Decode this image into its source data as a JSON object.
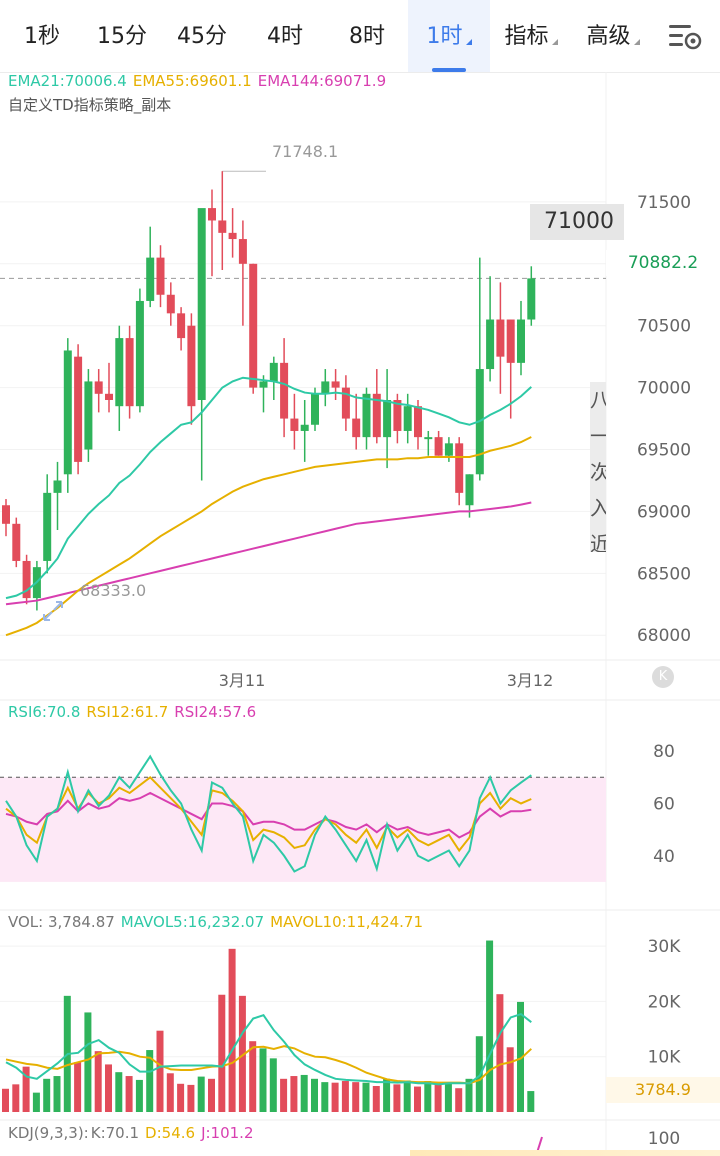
{
  "tabs": [
    {
      "label": "1秒",
      "active": false
    },
    {
      "label": "15分",
      "active": false
    },
    {
      "label": "45分",
      "active": false
    },
    {
      "label": "4时",
      "active": false
    },
    {
      "label": "8时",
      "active": false
    },
    {
      "label": "1时",
      "active": true
    },
    {
      "label": "指标",
      "active": false,
      "dropdown": true
    },
    {
      "label": "高级",
      "active": false,
      "dropdown": true
    }
  ],
  "settings_icon": "chart-settings-icon",
  "main_legend": {
    "ema21": "EMA21:70006.4",
    "ema55": "EMA55:69601.1",
    "ema144": "EMA144:69071.9",
    "strategy": "自定义TD指标策略_副本"
  },
  "price_axis": [
    "71500",
    "71000",
    "70500",
    "70000",
    "69500",
    "69000",
    "68500",
    "68000"
  ],
  "current_price": "70882.2",
  "price_flag": "71000",
  "side_panel_text": "八一次入近",
  "high_label": "71748.1",
  "low_label": "68333.0",
  "date_labels": [
    "3月11",
    "3月12"
  ],
  "rsi_legend": {
    "rsi6": "RSI6:70.8",
    "rsi12": "RSI12:61.7",
    "rsi24": "RSI24:57.6"
  },
  "rsi_axis": [
    "80",
    "60",
    "40"
  ],
  "vol_legend": {
    "vol": "VOL: 3,784.87",
    "mavol5": "MAVOL5:16,232.07",
    "mavol10": "MAVOL10:11,424.71"
  },
  "vol_axis": [
    "30K",
    "20K",
    "10K"
  ],
  "current_volume": "3784.9",
  "kdj_legend": {
    "name": "KDJ(9,3,3):",
    "k": "K:70.1",
    "d": "D:54.6",
    "j": "J:101.2"
  },
  "kdj_axis": [
    "100"
  ],
  "colors": {
    "up": "#2fb35b",
    "down": "#e24c5a",
    "ema21": "#2ec9a6",
    "ema55": "#e6b000",
    "ema144": "#d83fb0",
    "rsi_band": "#fde8f6",
    "accent": "#3d7bea"
  },
  "chart_data": {
    "type": "candlestick",
    "candles": [
      {
        "o": 69050,
        "h": 69100,
        "l": 68800,
        "c": 68900
      },
      {
        "o": 68900,
        "h": 68950,
        "l": 68550,
        "c": 68600
      },
      {
        "o": 68600,
        "h": 68650,
        "l": 68250,
        "c": 68300
      },
      {
        "o": 68300,
        "h": 68600,
        "l": 68200,
        "c": 68550
      },
      {
        "o": 68600,
        "h": 69300,
        "l": 68500,
        "c": 69150
      },
      {
        "o": 69150,
        "h": 69400,
        "l": 68850,
        "c": 69250
      },
      {
        "o": 69300,
        "h": 70400,
        "l": 69150,
        "c": 70300
      },
      {
        "o": 70250,
        "h": 70350,
        "l": 69300,
        "c": 69400
      },
      {
        "o": 69500,
        "h": 70150,
        "l": 69400,
        "c": 70050
      },
      {
        "o": 70050,
        "h": 70150,
        "l": 69800,
        "c": 69950
      },
      {
        "o": 69950,
        "h": 70200,
        "l": 69800,
        "c": 69900
      },
      {
        "o": 69850,
        "h": 70500,
        "l": 69650,
        "c": 70400
      },
      {
        "o": 70400,
        "h": 70500,
        "l": 69750,
        "c": 69850
      },
      {
        "o": 69850,
        "h": 70800,
        "l": 69800,
        "c": 70700
      },
      {
        "o": 70700,
        "h": 71300,
        "l": 70650,
        "c": 71050
      },
      {
        "o": 71050,
        "h": 71150,
        "l": 70650,
        "c": 70750
      },
      {
        "o": 70750,
        "h": 70850,
        "l": 70500,
        "c": 70600
      },
      {
        "o": 70600,
        "h": 70650,
        "l": 70300,
        "c": 70400
      },
      {
        "o": 70500,
        "h": 70600,
        "l": 69700,
        "c": 69850
      },
      {
        "o": 69900,
        "h": 71000,
        "l": 69250,
        "c": 71450
      },
      {
        "o": 71450,
        "h": 71600,
        "l": 70900,
        "c": 71350
      },
      {
        "o": 71350,
        "h": 71748.1,
        "l": 70950,
        "c": 71250
      },
      {
        "o": 71250,
        "h": 71450,
        "l": 71050,
        "c": 71200
      },
      {
        "o": 71200,
        "h": 71350,
        "l": 70500,
        "c": 71000
      },
      {
        "o": 71000,
        "h": 71000,
        "l": 69950,
        "c": 70000
      },
      {
        "o": 70000,
        "h": 70100,
        "l": 69800,
        "c": 70050
      },
      {
        "o": 70050,
        "h": 70250,
        "l": 69900,
        "c": 70200
      },
      {
        "o": 70200,
        "h": 70400,
        "l": 69600,
        "c": 69750
      },
      {
        "o": 69750,
        "h": 69950,
        "l": 69500,
        "c": 69650
      },
      {
        "o": 69650,
        "h": 69900,
        "l": 69400,
        "c": 69700
      },
      {
        "o": 69700,
        "h": 70000,
        "l": 69650,
        "c": 69950
      },
      {
        "o": 69950,
        "h": 70150,
        "l": 69850,
        "c": 70050
      },
      {
        "o": 70050,
        "h": 70150,
        "l": 69900,
        "c": 70000
      },
      {
        "o": 70000,
        "h": 70100,
        "l": 69650,
        "c": 69750
      },
      {
        "o": 69750,
        "h": 69950,
        "l": 69500,
        "c": 69600
      },
      {
        "o": 69600,
        "h": 70000,
        "l": 69500,
        "c": 69950
      },
      {
        "o": 69950,
        "h": 70150,
        "l": 69550,
        "c": 69600
      },
      {
        "o": 69600,
        "h": 70150,
        "l": 69350,
        "c": 69900
      },
      {
        "o": 69900,
        "h": 69950,
        "l": 69550,
        "c": 69650
      },
      {
        "o": 69650,
        "h": 69950,
        "l": 69550,
        "c": 69850
      },
      {
        "o": 69850,
        "h": 69900,
        "l": 69500,
        "c": 69600
      },
      {
        "o": 69600,
        "h": 69650,
        "l": 69450,
        "c": 69600
      },
      {
        "o": 69600,
        "h": 69650,
        "l": 69450,
        "c": 69450
      },
      {
        "o": 69450,
        "h": 69600,
        "l": 69400,
        "c": 69550
      },
      {
        "o": 69550,
        "h": 69600,
        "l": 69050,
        "c": 69150
      },
      {
        "o": 69050,
        "h": 69300,
        "l": 68950,
        "c": 69300
      },
      {
        "o": 69300,
        "h": 71050,
        "l": 69250,
        "c": 70150
      },
      {
        "o": 70150,
        "h": 70900,
        "l": 70050,
        "c": 70550
      },
      {
        "o": 70550,
        "h": 70850,
        "l": 69950,
        "c": 70250
      },
      {
        "o": 70550,
        "h": 70550,
        "l": 69750,
        "c": 70200
      },
      {
        "o": 70200,
        "h": 70700,
        "l": 70100,
        "c": 70550
      },
      {
        "o": 70550,
        "h": 70980,
        "l": 70500,
        "c": 70882.2
      }
    ],
    "ema21": [
      68300,
      68320,
      68360,
      68430,
      68520,
      68620,
      68780,
      68880,
      68980,
      69060,
      69130,
      69230,
      69290,
      69380,
      69480,
      69560,
      69630,
      69700,
      69720,
      69800,
      69900,
      70000,
      70050,
      70080,
      70070,
      70060,
      70050,
      70030,
      69990,
      69960,
      69950,
      69950,
      69960,
      69950,
      69920,
      69910,
      69900,
      69890,
      69870,
      69860,
      69840,
      69820,
      69790,
      69760,
      69720,
      69700,
      69730,
      69780,
      69820,
      69870,
      69930,
      70006.4
    ],
    "ema55": [
      68000,
      68030,
      68060,
      68100,
      68160,
      68220,
      68290,
      68360,
      68420,
      68470,
      68520,
      68570,
      68620,
      68680,
      68740,
      68800,
      68850,
      68900,
      68950,
      69000,
      69060,
      69110,
      69160,
      69200,
      69230,
      69260,
      69280,
      69300,
      69320,
      69340,
      69360,
      69370,
      69380,
      69390,
      69400,
      69410,
      69420,
      69420,
      69420,
      69430,
      69430,
      69440,
      69440,
      69440,
      69440,
      69440,
      69460,
      69490,
      69510,
      69530,
      69560,
      69601.1
    ],
    "ema144": [
      68250,
      68260,
      68270,
      68280,
      68300,
      68320,
      68340,
      68360,
      68380,
      68400,
      68420,
      68440,
      68460,
      68480,
      68500,
      68520,
      68540,
      68560,
      68580,
      68600,
      68620,
      68640,
      68660,
      68680,
      68700,
      68720,
      68740,
      68760,
      68780,
      68800,
      68820,
      68840,
      68860,
      68880,
      68900,
      68910,
      68920,
      68930,
      68940,
      68950,
      68960,
      68970,
      68980,
      68990,
      69000,
      69000,
      69010,
      69020,
      69030,
      69040,
      69055,
      69071.9
    ],
    "rsi6": [
      61,
      55,
      44,
      38,
      55,
      58,
      72,
      57,
      65,
      59,
      63,
      70,
      66,
      72,
      78,
      71,
      65,
      60,
      50,
      42,
      68,
      66,
      60,
      55,
      38,
      48,
      45,
      40,
      34,
      36,
      48,
      55,
      50,
      44,
      38,
      46,
      35,
      52,
      42,
      48,
      40,
      38,
      40,
      42,
      36,
      42,
      62,
      70,
      60,
      65,
      68,
      70.8
    ],
    "rsi12": [
      58,
      55,
      48,
      45,
      55,
      58,
      66,
      58,
      64,
      60,
      62,
      66,
      64,
      67,
      70,
      66,
      62,
      58,
      53,
      48,
      65,
      64,
      61,
      57,
      46,
      50,
      49,
      47,
      43,
      44,
      50,
      54,
      52,
      48,
      45,
      50,
      43,
      51,
      47,
      50,
      46,
      44,
      46,
      48,
      42,
      47,
      60,
      64,
      58,
      62,
      60,
      61.7
    ],
    "rsi24": [
      56,
      55,
      53,
      52,
      56,
      57,
      61,
      57,
      60,
      58,
      59,
      62,
      61,
      62,
      64,
      62,
      60,
      58,
      56,
      54,
      60,
      60,
      59,
      57,
      52,
      53,
      53,
      52,
      50,
      50,
      52,
      54,
      53,
      51,
      50,
      52,
      49,
      52,
      50,
      51,
      49,
      48,
      49,
      50,
      47,
      49,
      55,
      58,
      55,
      57,
      57,
      57.6
    ],
    "volume": [
      4200,
      5000,
      8200,
      3500,
      6000,
      6500,
      21000,
      9000,
      18000,
      11000,
      8600,
      7200,
      6500,
      5800,
      11200,
      14700,
      7000,
      5100,
      4900,
      6400,
      6000,
      21200,
      29500,
      21000,
      12800,
      11500,
      9700,
      6000,
      6500,
      6700,
      6000,
      5400,
      5300,
      5600,
      5400,
      5300,
      4700,
      6000,
      5000,
      5700,
      4600,
      5600,
      5100,
      5200,
      4300,
      6000,
      13700,
      31000,
      21300,
      11700,
      19900,
      3784.87
    ],
    "mavol5": [
      9000,
      8000,
      6400,
      6000,
      7400,
      8800,
      10500,
      10700,
      12300,
      13000,
      11600,
      10700,
      8600,
      7300,
      7300,
      8200,
      8300,
      8400,
      8400,
      8400,
      8400,
      8200,
      11300,
      14400,
      16900,
      17500,
      14800,
      12700,
      10300,
      8600,
      7600,
      6700,
      6000,
      5800,
      5700,
      5600,
      5400,
      5400,
      5300,
      5400,
      5200,
      5200,
      5000,
      5200,
      5200,
      5200,
      6600,
      10500,
      14300,
      17100,
      17700,
      16232.07
    ],
    "mavol10": [
      9500,
      9100,
      8700,
      8500,
      8000,
      7800,
      8500,
      9000,
      9500,
      10600,
      10700,
      10900,
      10600,
      10000,
      9800,
      8400,
      7700,
      7600,
      7600,
      7900,
      8200,
      8300,
      8900,
      10300,
      11700,
      11800,
      11400,
      11900,
      11500,
      10600,
      10000,
      9900,
      9400,
      8800,
      8000,
      7100,
      6500,
      5900,
      5600,
      5500,
      5400,
      5400,
      5300,
      5300,
      5300,
      5200,
      5800,
      7600,
      8600,
      9000,
      9700,
      11424.71
    ],
    "price_range": [
      67800,
      72000
    ],
    "rsi_range": [
      25,
      90
    ],
    "volume_range": [
      0,
      32000
    ]
  }
}
